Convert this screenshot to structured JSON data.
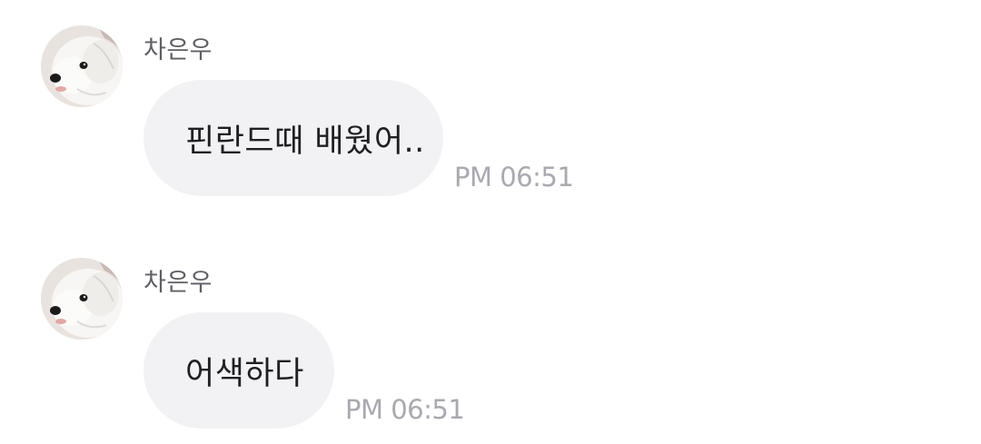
{
  "colors": {
    "background": "#ffffff",
    "bubble": "#f2f2f4",
    "sender_text": "#5f5f66",
    "message_text": "#1f1f24",
    "timestamp_text": "#a9a9b0"
  },
  "messages": [
    {
      "avatar_icon": "white-dog-profile-photo",
      "sender": "차은우",
      "text": "핀란드때 배웠어..",
      "time": "PM 06:51"
    },
    {
      "avatar_icon": "white-dog-profile-photo",
      "sender": "차은우",
      "text": "어색하다",
      "time": "PM 06:51"
    }
  ]
}
